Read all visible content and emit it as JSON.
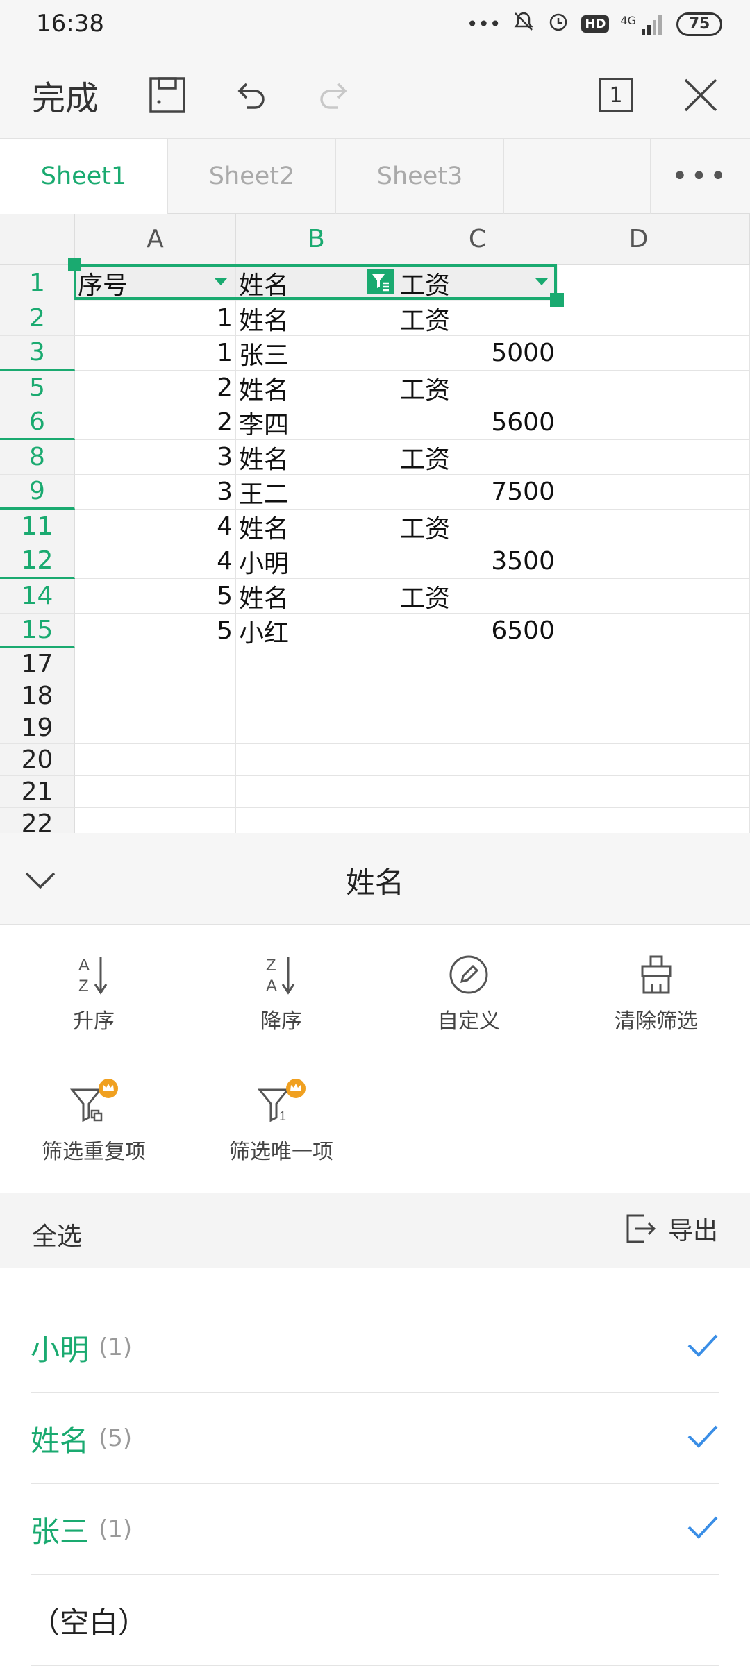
{
  "status": {
    "time": "16:38",
    "battery": "75",
    "network": "4G",
    "hd": "HD"
  },
  "toolbar": {
    "done": "完成",
    "sheet_count": "1"
  },
  "tabs": [
    "Sheet1",
    "Sheet2",
    "Sheet3"
  ],
  "columns": [
    "A",
    "B",
    "C",
    "D"
  ],
  "rows": [
    {
      "num": "1",
      "a": "序号",
      "b": "姓名",
      "c": "工资",
      "c_num": false,
      "a_num": false
    },
    {
      "num": "2",
      "a": "1",
      "b": "姓名",
      "c": "工资",
      "c_num": false,
      "a_num": true
    },
    {
      "num": "3",
      "a": "1",
      "b": "张三",
      "c": "5000",
      "c_num": true,
      "a_num": true
    },
    {
      "num": "5",
      "a": "2",
      "b": "姓名",
      "c": "工资",
      "c_num": false,
      "a_num": true
    },
    {
      "num": "6",
      "a": "2",
      "b": "李四",
      "c": "5600",
      "c_num": true,
      "a_num": true
    },
    {
      "num": "8",
      "a": "3",
      "b": "姓名",
      "c": "工资",
      "c_num": false,
      "a_num": true
    },
    {
      "num": "9",
      "a": "3",
      "b": "王二",
      "c": "7500",
      "c_num": true,
      "a_num": true
    },
    {
      "num": "11",
      "a": "4",
      "b": "姓名",
      "c": "工资",
      "c_num": false,
      "a_num": true
    },
    {
      "num": "12",
      "a": "4",
      "b": "小明",
      "c": "3500",
      "c_num": true,
      "a_num": true
    },
    {
      "num": "14",
      "a": "5",
      "b": "姓名",
      "c": "工资",
      "c_num": false,
      "a_num": true
    },
    {
      "num": "15",
      "a": "5",
      "b": "小红",
      "c": "6500",
      "c_num": true,
      "a_num": true
    },
    {
      "num": "17",
      "a": "",
      "b": "",
      "c": "",
      "c_num": false,
      "a_num": false
    },
    {
      "num": "18",
      "a": "",
      "b": "",
      "c": "",
      "c_num": false,
      "a_num": false
    },
    {
      "num": "19",
      "a": "",
      "b": "",
      "c": "",
      "c_num": false,
      "a_num": false
    },
    {
      "num": "20",
      "a": "",
      "b": "",
      "c": "",
      "c_num": false,
      "a_num": false
    },
    {
      "num": "21",
      "a": "",
      "b": "",
      "c": "",
      "c_num": false,
      "a_num": false
    },
    {
      "num": "22",
      "a": "",
      "b": "",
      "c": "",
      "c_num": false,
      "a_num": false
    }
  ],
  "filter": {
    "title": "姓名",
    "actions": [
      "升序",
      "降序",
      "自定义",
      "清除筛选"
    ],
    "actions2": [
      "筛选重复项",
      "筛选唯一项"
    ],
    "select_all": "全选",
    "export": "导出",
    "options": [
      {
        "name": "小明",
        "count": "(1)",
        "checked": true
      },
      {
        "name": "姓名",
        "count": "(5)",
        "checked": true
      },
      {
        "name": "张三",
        "count": "(1)",
        "checked": true
      },
      {
        "name": "（空白）",
        "count": "",
        "checked": false
      }
    ]
  },
  "colors": {
    "accent": "#1aaa70",
    "check": "#3a8ee6",
    "badge": "#f0a020"
  }
}
